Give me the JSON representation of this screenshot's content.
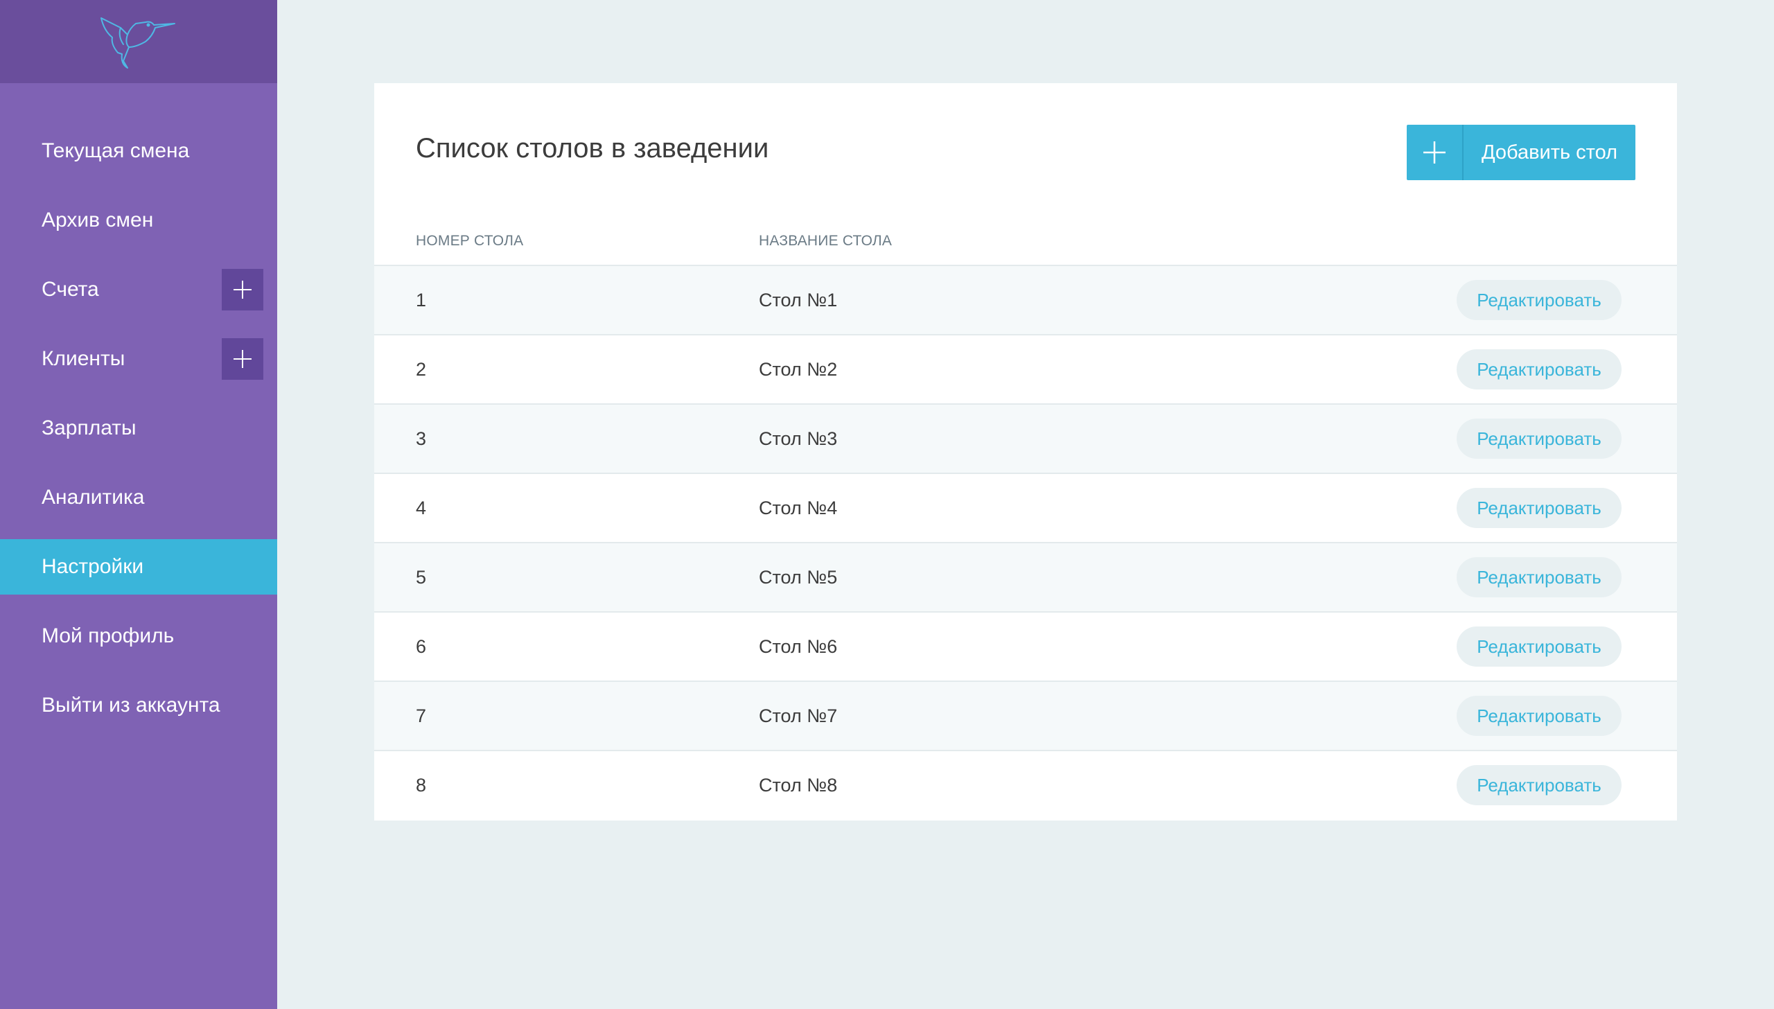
{
  "sidebar": {
    "logo_icon": "hummingbird-logo",
    "items": [
      {
        "label": "Текущая смена",
        "has_plus": false,
        "active": false
      },
      {
        "label": "Архив смен",
        "has_plus": false,
        "active": false
      },
      {
        "label": "Счета",
        "has_plus": true,
        "active": false
      },
      {
        "label": "Клиенты",
        "has_plus": true,
        "active": false
      },
      {
        "label": "Зарплаты",
        "has_plus": false,
        "active": false
      },
      {
        "label": "Аналитика",
        "has_plus": false,
        "active": false
      },
      {
        "label": "Настройки",
        "has_plus": false,
        "active": true
      },
      {
        "label": "Мой профиль",
        "has_plus": false,
        "active": false
      },
      {
        "label": "Выйти из аккаунта",
        "has_plus": false,
        "active": false
      }
    ]
  },
  "main": {
    "title": "Список столов в заведении",
    "add_button_label": "Добавить стол",
    "columns": {
      "number": "НОМЕР СТОЛА",
      "name": "НАЗВАНИЕ СТОЛА"
    },
    "edit_label": "Редактировать",
    "rows": [
      {
        "number": "1",
        "name": "Стол №1"
      },
      {
        "number": "2",
        "name": "Стол №2"
      },
      {
        "number": "3",
        "name": "Стол №3"
      },
      {
        "number": "4",
        "name": "Стол №4"
      },
      {
        "number": "5",
        "name": "Стол №5"
      },
      {
        "number": "6",
        "name": "Стол №6"
      },
      {
        "number": "7",
        "name": "Стол №7"
      },
      {
        "number": "8",
        "name": "Стол №8"
      }
    ]
  },
  "colors": {
    "sidebar_bg": "#7f62b4",
    "sidebar_logo_bg": "#6a4e9c",
    "accent": "#3ab5da",
    "page_bg": "#e8f0f2"
  }
}
